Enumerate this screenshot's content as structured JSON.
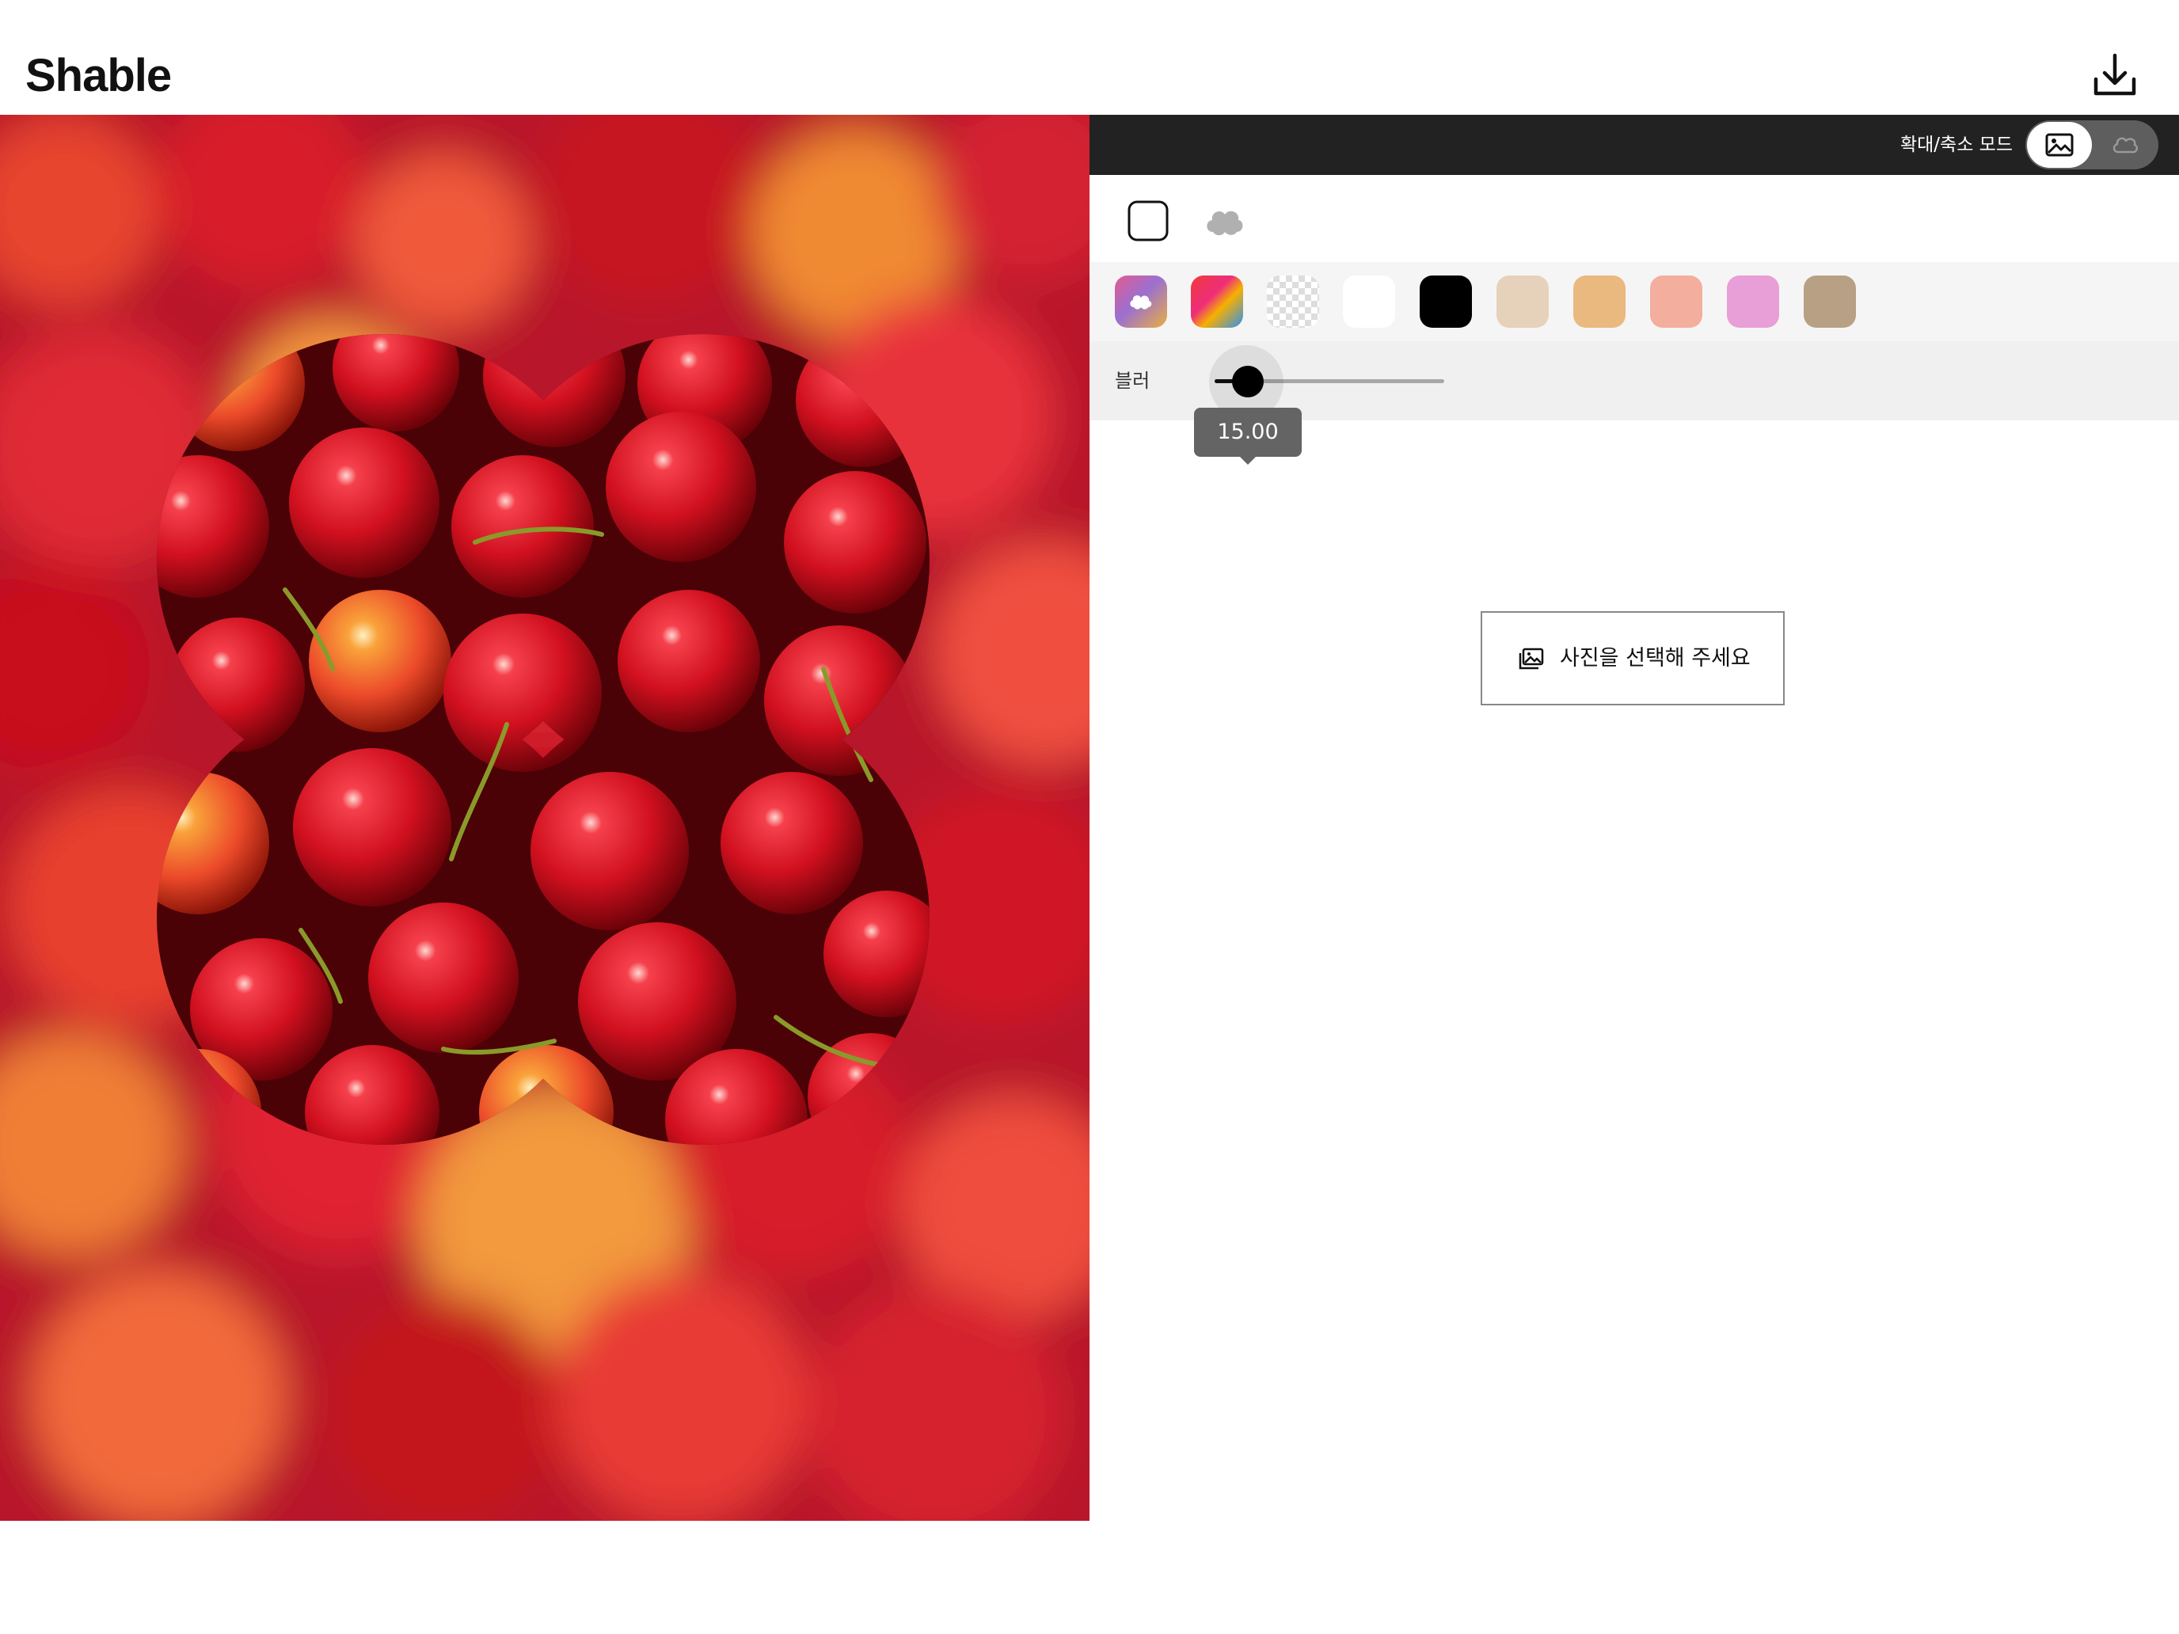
{
  "header": {
    "logo": "Shable",
    "download_icon": "download-icon"
  },
  "canvas": {
    "photo_subject": "cherries",
    "shape": "flower",
    "background": "blurred photo"
  },
  "panel": {
    "mode_label": "확대/축소 모드",
    "mode_toggle": {
      "options": [
        "image-icon",
        "cloud-icon"
      ],
      "selected": "image-icon"
    },
    "shapes": [
      {
        "name": "rounded-square-icon",
        "selected": true
      },
      {
        "name": "cloud-icon",
        "selected": false
      }
    ],
    "colors": [
      {
        "name": "photo-background",
        "color": "#e0609a"
      },
      {
        "name": "multicolor",
        "color": "#f02f4f"
      },
      {
        "name": "transparent",
        "color": "checker"
      },
      {
        "name": "white",
        "color": "#ffffff"
      },
      {
        "name": "black",
        "color": "#000000"
      },
      {
        "name": "beige",
        "color": "#e6d2ba"
      },
      {
        "name": "orange",
        "color": "#e9b97f"
      },
      {
        "name": "salmon",
        "color": "#f4ae9d"
      },
      {
        "name": "pink",
        "color": "#e89ed6"
      },
      {
        "name": "brown",
        "color": "#b8a084"
      }
    ],
    "blur": {
      "label": "블러",
      "value": 15,
      "value_text": "15.00"
    },
    "select_photo_label": "사진을 선택해 주세요"
  }
}
